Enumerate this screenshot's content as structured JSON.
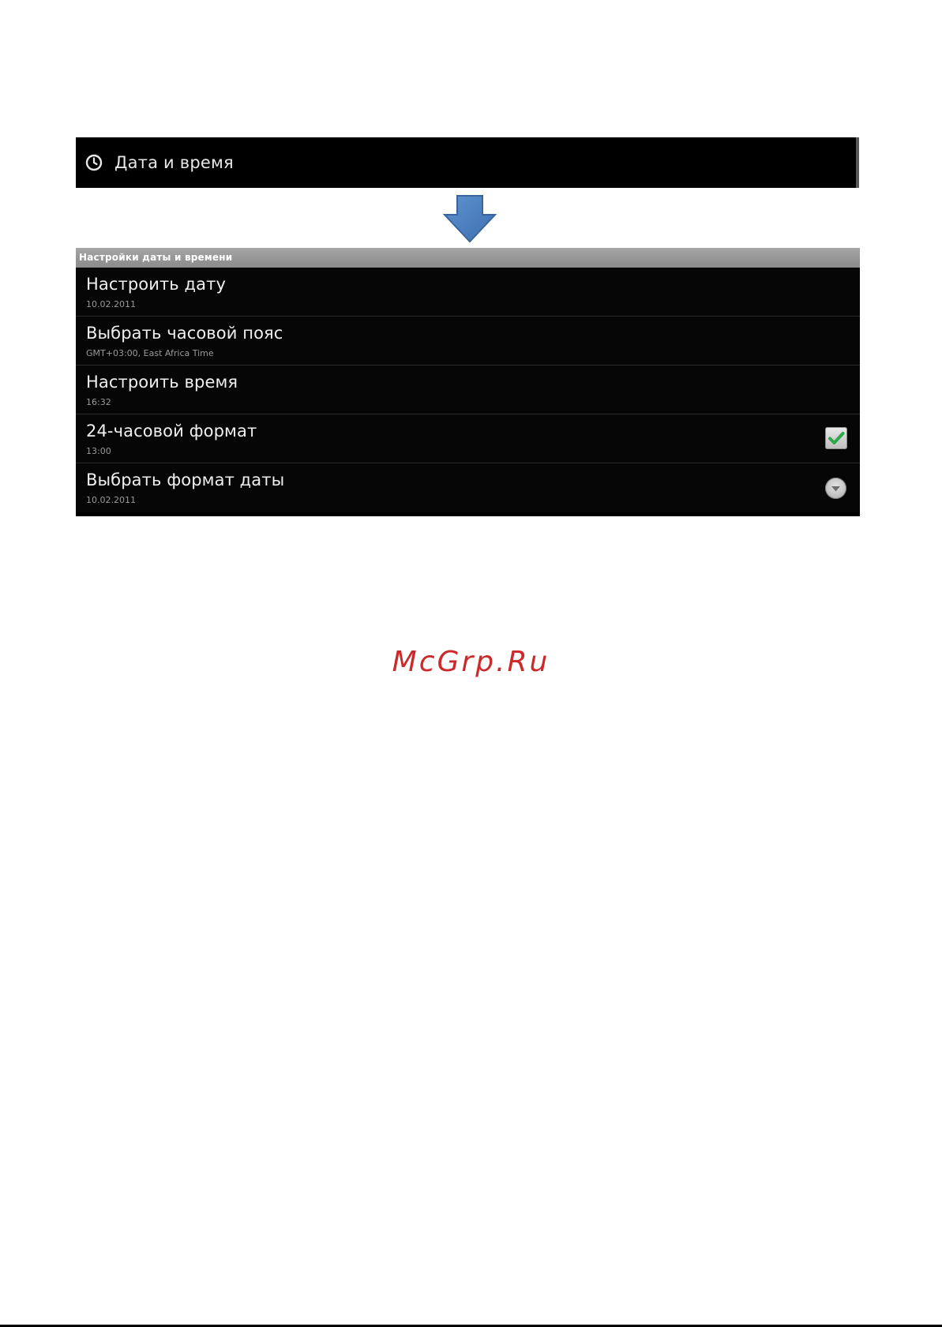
{
  "top_setting": {
    "icon": "clock-icon",
    "label": "Дата и время"
  },
  "arrow": {
    "icon": "arrow-down-icon",
    "color": "#4a7ebd"
  },
  "settings_screen": {
    "header": "Настройки даты и времени",
    "rows": [
      {
        "title": "Настроить дату",
        "summary": "10.02.2011"
      },
      {
        "title": "Выбрать часовой пояс",
        "summary": "GMT+03:00, East Africa Time"
      },
      {
        "title": "Настроить время",
        "summary": "16:32"
      },
      {
        "title": "24-часовой формат",
        "summary": "13:00",
        "control": "checkbox",
        "checked": true
      },
      {
        "title": "Выбрать формат даты",
        "summary": "10.02.2011",
        "control": "dropdown"
      }
    ]
  },
  "watermark": "McGrp.Ru"
}
